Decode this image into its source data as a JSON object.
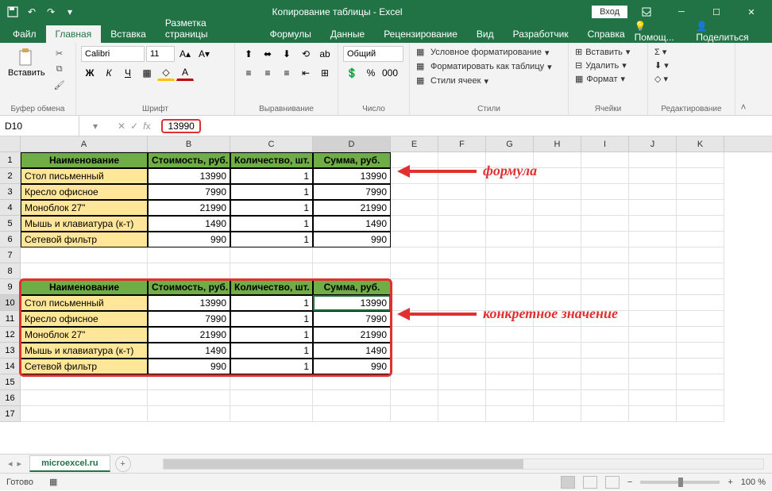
{
  "title": "Копирование таблицы - Excel",
  "signin": "Вход",
  "tabs": [
    "Файл",
    "Главная",
    "Вставка",
    "Разметка страницы",
    "Формулы",
    "Данные",
    "Рецензирование",
    "Вид",
    "Разработчик",
    "Справка"
  ],
  "help": {
    "tell": "Помощ...",
    "share": "Поделиться"
  },
  "ribbon": {
    "clipboard": {
      "label": "Буфер обмена",
      "paste": "Вставить"
    },
    "font": {
      "label": "Шрифт",
      "name": "Calibri",
      "size": "11"
    },
    "alignment": {
      "label": "Выравнивание"
    },
    "number": {
      "label": "Число",
      "format": "Общий"
    },
    "styles": {
      "label": "Стили",
      "cond": "Условное форматирование",
      "table": "Форматировать как таблицу",
      "cell": "Стили ячеек"
    },
    "cells": {
      "label": "Ячейки",
      "insert": "Вставить",
      "delete": "Удалить",
      "format": "Формат"
    },
    "editing": {
      "label": "Редактирование"
    }
  },
  "namebox": "D10",
  "formula": "13990",
  "columns": [
    "A",
    "B",
    "C",
    "D",
    "E",
    "F",
    "G",
    "H",
    "I",
    "J",
    "K"
  ],
  "table": {
    "headers": [
      "Наименование",
      "Стоимость, руб.",
      "Количество, шт.",
      "Сумма, руб."
    ],
    "rows": [
      {
        "name": "Стол письменный",
        "cost": 13990,
        "qty": 1,
        "sum": 13990
      },
      {
        "name": "Кресло офисное",
        "cost": 7990,
        "qty": 1,
        "sum": 7990
      },
      {
        "name": "Моноблок 27\"",
        "cost": 21990,
        "qty": 1,
        "sum": 21990
      },
      {
        "name": "Мышь и клавиатура (к-т)",
        "cost": 1490,
        "qty": 1,
        "sum": 1490
      },
      {
        "name": "Сетевой фильтр",
        "cost": 990,
        "qty": 1,
        "sum": 990
      }
    ]
  },
  "annotations": {
    "formula": "формула",
    "value": "конкретное значение"
  },
  "sheet": "microexcel.ru",
  "status": "Готово",
  "zoom": "100 %"
}
